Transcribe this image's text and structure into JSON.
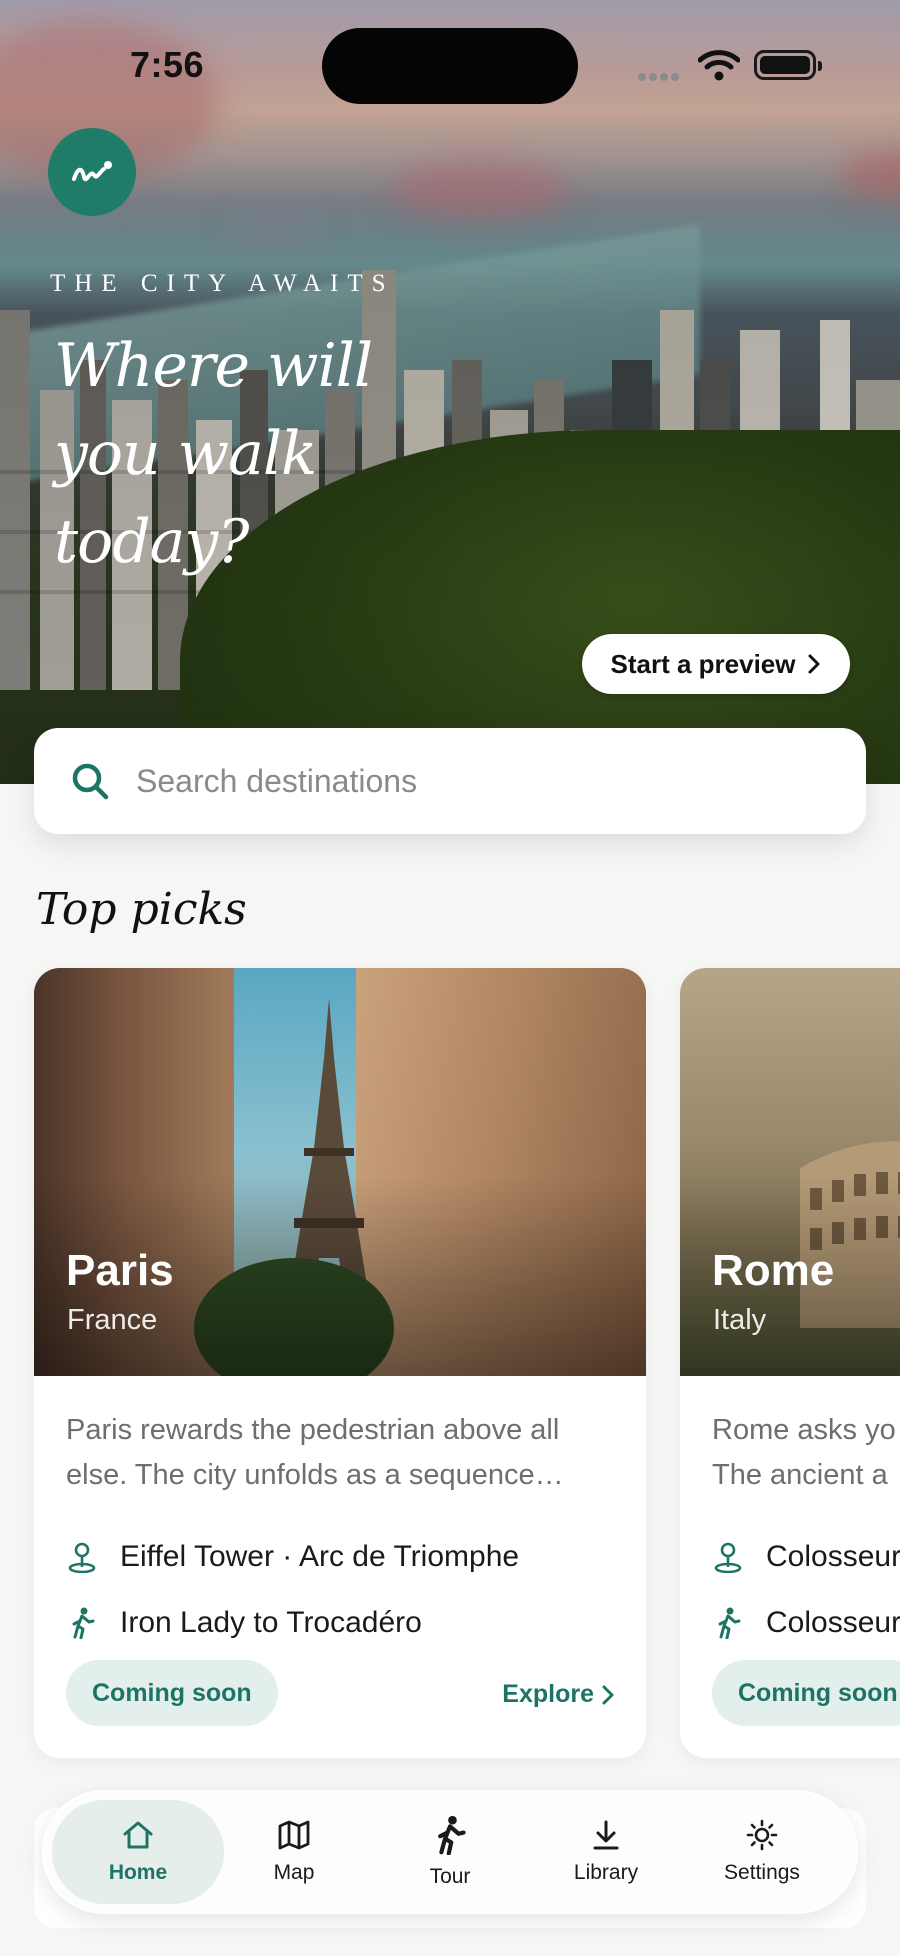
{
  "status_bar": {
    "time": "7:56"
  },
  "hero": {
    "eyebrow": "THE CITY AWAITS",
    "headline": "Where will you walk today?",
    "preview_button": "Start a preview"
  },
  "search": {
    "placeholder": "Search destinations"
  },
  "top_picks": {
    "title": "Top picks",
    "cards": [
      {
        "city": "Paris",
        "country": "France",
        "description": "Paris rewards the pedestrian above all else. The city unfolds as a sequence…",
        "landmarks": "Eiffel Tower · Arc de Triomphe",
        "walk": "Iron Lady to Trocadéro",
        "status": "Coming soon",
        "action": "Explore"
      },
      {
        "city": "Rome",
        "country": "Italy",
        "description": "Rome asks yo… The ancient a…",
        "description_line1": "Rome asks yo",
        "description_line2": "The ancient a",
        "landmarks": "Colosseur",
        "walk": "Colosseur",
        "status": "Coming soon"
      }
    ]
  },
  "tab_bar": {
    "items": [
      {
        "label": "Home",
        "icon": "home-icon",
        "active": true
      },
      {
        "label": "Map",
        "icon": "map-icon",
        "active": false
      },
      {
        "label": "Tour",
        "icon": "walking-icon",
        "active": false
      },
      {
        "label": "Library",
        "icon": "download-icon",
        "active": false
      },
      {
        "label": "Settings",
        "icon": "sun-gear-icon",
        "active": false
      }
    ]
  },
  "colors": {
    "accent": "#1d7464",
    "logo_bg": "#1f7c69",
    "pill_bg": "#e3efec"
  }
}
